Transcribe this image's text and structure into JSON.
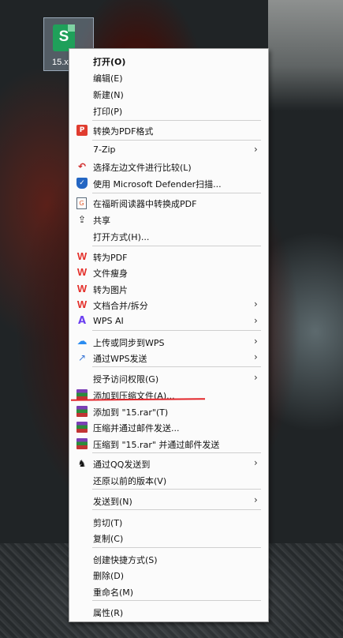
{
  "desktop": {
    "icon_label": "15.x",
    "icon_letter": "S"
  },
  "menu": {
    "items": [
      {
        "label": "打开(O)",
        "icon": "none",
        "bold": true
      },
      {
        "label": "编辑(E)",
        "icon": "none"
      },
      {
        "label": "新建(N)",
        "icon": "none"
      },
      {
        "label": "打印(P)",
        "icon": "none"
      },
      {
        "label": "转换为PDF格式",
        "icon": "pdf-convert-icon"
      },
      {
        "label": "7-Zip",
        "icon": "none",
        "submenu": true
      },
      {
        "label": "选择左边文件进行比较(L)",
        "icon": "compare-icon"
      },
      {
        "label": "使用 Microsoft Defender扫描...",
        "icon": "defender-shield-icon"
      },
      {
        "label": "在福昕阅读器中转换成PDF",
        "icon": "foxit-icon"
      },
      {
        "label": "共享",
        "icon": "share-icon"
      },
      {
        "label": "打开方式(H)...",
        "icon": "none"
      },
      {
        "label": "转为PDF",
        "icon": "wps-icon"
      },
      {
        "label": "文件瘦身",
        "icon": "wps-icon"
      },
      {
        "label": "转为图片",
        "icon": "wps-icon"
      },
      {
        "label": "文档合并/拆分",
        "icon": "wps-icon",
        "submenu": true
      },
      {
        "label": "WPS AI",
        "icon": "wps-ai-icon",
        "submenu": true
      },
      {
        "label": "上传或同步到WPS",
        "icon": "cloud-icon",
        "submenu": true
      },
      {
        "label": "通过WPS发送",
        "icon": "send-icon",
        "submenu": true
      },
      {
        "label": "授予访问权限(G)",
        "icon": "none",
        "submenu": true
      },
      {
        "label": "添加到压缩文件(A)...",
        "icon": "winrar-icon"
      },
      {
        "label": "添加到 \"15.rar\"(T)",
        "icon": "winrar-icon"
      },
      {
        "label": "压缩并通过邮件发送...",
        "icon": "winrar-icon"
      },
      {
        "label": "压缩到 \"15.rar\" 并通过邮件发送",
        "icon": "winrar-icon"
      },
      {
        "label": "通过QQ发送到",
        "icon": "qq-icon",
        "submenu": true
      },
      {
        "label": "还原以前的版本(V)",
        "icon": "none"
      },
      {
        "label": "发送到(N)",
        "icon": "none",
        "submenu": true
      },
      {
        "label": "剪切(T)",
        "icon": "none"
      },
      {
        "label": "复制(C)",
        "icon": "none"
      },
      {
        "label": "创建快捷方式(S)",
        "icon": "none"
      },
      {
        "label": "删除(D)",
        "icon": "none"
      },
      {
        "label": "重命名(M)",
        "icon": "none"
      },
      {
        "label": "属性(R)",
        "icon": "none"
      }
    ],
    "submenu_arrow": "›",
    "icon_glyphs": {
      "pdf": "P",
      "undo": "↶",
      "defender": "✓",
      "foxit": "G",
      "share": "⇪",
      "wps": "W",
      "ai": "A",
      "cloud": "☁",
      "send": "↗",
      "qq": "♞"
    }
  },
  "colors": {
    "menu_bg": "#fbfbfb",
    "highlight_underline": "#e3262b",
    "wps_red": "#e4302b",
    "sheet_green": "#1fa05a"
  }
}
